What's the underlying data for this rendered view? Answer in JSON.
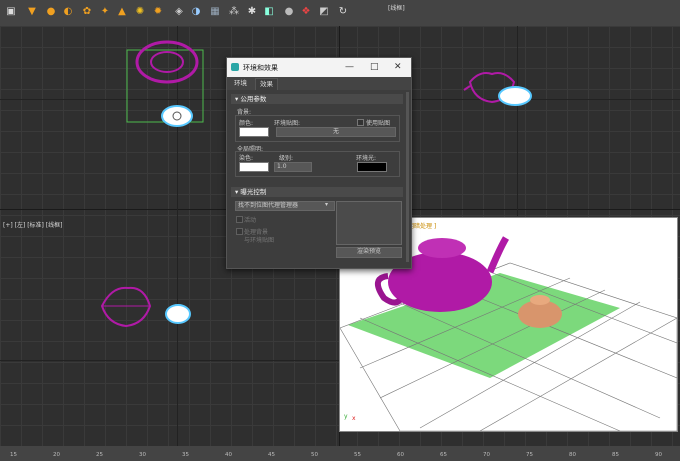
{
  "toolbar": {
    "icons": [
      "camera-icon",
      "spot-light-icon",
      "omni-light-icon",
      "sun-icon",
      "sunflower-icon",
      "direct-light-icon",
      "skylight-icon",
      "sparkle-icon",
      "sun-ray-icon",
      "box-icon",
      "sphere-half-icon",
      "grid-plane-icon",
      "array-icon",
      "grass-icon",
      "modifier-icon",
      "sphere-gray-icon",
      "color-palette-icon",
      "material-icon",
      "refresh-icon"
    ],
    "top_right_label": "[线框]"
  },
  "viewports": {
    "left_label": "[+] [左] [标准] [线框]",
    "render_label_suffix": "明暗处理 ]"
  },
  "dialog": {
    "title": "环境和效果",
    "window_buttons": {
      "minimize": "—",
      "maximize": "□",
      "close": "✕"
    },
    "tabs": [
      "环境",
      "效果"
    ],
    "common": {
      "header": "公用参数",
      "background": "背景:",
      "color": "颜色:",
      "env_map": "环境贴图:",
      "use_map": "使用贴图",
      "map_value": "无",
      "global_lighting": "全局照明:",
      "tint": "染色:",
      "level": "级别:",
      "level_value": "1.0",
      "ambient": "环境光:",
      "background_color": "#ffffff",
      "tint_color": "#ffffff",
      "ambient_color": "#000000"
    },
    "exposure": {
      "header": "曝光控制",
      "dropdown_value": "找不到位图代理管理器",
      "active": "活动",
      "process_bg_line1": "处理背景",
      "process_bg_line2": "与环境贴图",
      "render_preview": "渲染预览"
    }
  },
  "ruler": {
    "ticks": [
      "15",
      "20",
      "25",
      "30",
      "35",
      "40",
      "45",
      "50",
      "55",
      "60",
      "65",
      "70",
      "75",
      "80",
      "85",
      "90"
    ]
  },
  "colors": {
    "teapot_main": "#b01aa6",
    "teapot_small": "#d8956c",
    "ground": "#7cd97c",
    "selection": "#57c8ff"
  }
}
